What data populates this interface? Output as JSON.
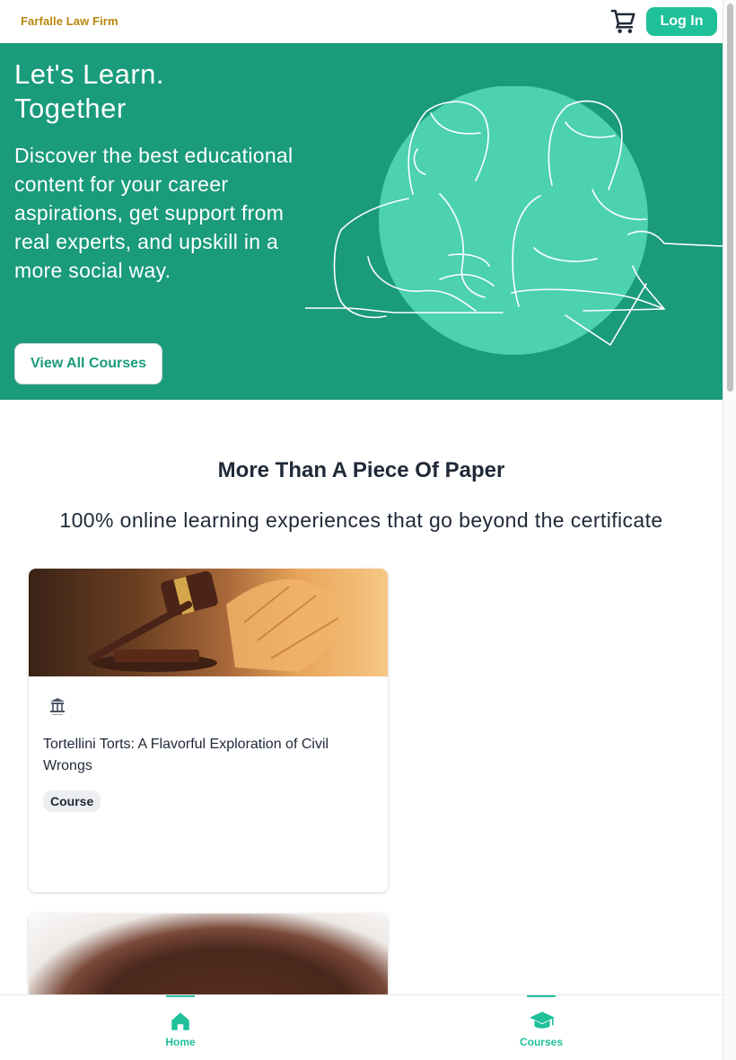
{
  "header": {
    "brand": "Farfalle Law Firm",
    "cart_icon": "shopping-cart-icon",
    "login_label": "Log In"
  },
  "hero": {
    "title": "Let's Learn. Together",
    "description": "Discover the best educational content for your career aspirations, get support from real experts, and upskill in a more social way.",
    "button_label": "View All Courses",
    "illustration": "students-studying-illustration"
  },
  "section": {
    "title": "More Than A Piece Of Paper",
    "subtitle": "100% online learning experiences that go beyond the certificate"
  },
  "courses": [
    {
      "image": "gavel-and-books-photo",
      "logo": "law-firm-logo",
      "title": "Tortellini Torts: A Flavorful Exploration of Civil Wrongs",
      "tag": "Course"
    },
    {
      "image": "chocolate-cookie-photo"
    }
  ],
  "bottom_nav": {
    "items": [
      {
        "label": "Home",
        "icon": "home-icon"
      },
      {
        "label": "Courses",
        "icon": "graduation-cap-icon"
      }
    ]
  },
  "colors": {
    "accent": "#1fc09a",
    "hero_bg": "#1a9b7b",
    "hero_circle": "#4cd1b1",
    "brand": "#b8860b"
  }
}
